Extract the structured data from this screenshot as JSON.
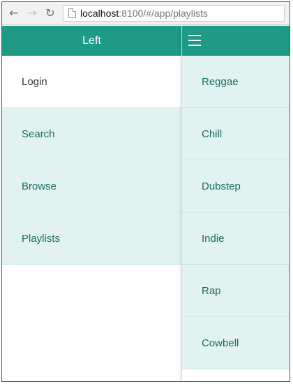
{
  "browser": {
    "back_icon": "back-arrow-icon",
    "forward_icon": "forward-arrow-icon",
    "reload_icon": "reload-icon",
    "url_host": "localhost",
    "url_rest": ":8100/#/app/playlists"
  },
  "left_menu": {
    "title": "Left",
    "items": [
      {
        "label": "Login"
      },
      {
        "label": "Search"
      },
      {
        "label": "Browse"
      },
      {
        "label": "Playlists"
      }
    ]
  },
  "playlists": {
    "items": [
      {
        "label": "Reggae"
      },
      {
        "label": "Chill"
      },
      {
        "label": "Dubstep"
      },
      {
        "label": "Indie"
      },
      {
        "label": "Rap"
      },
      {
        "label": "Cowbell"
      }
    ]
  },
  "colors": {
    "header": "#1f9a85",
    "item_tint": "#e2f2f1",
    "item_text": "#1a6b61"
  }
}
